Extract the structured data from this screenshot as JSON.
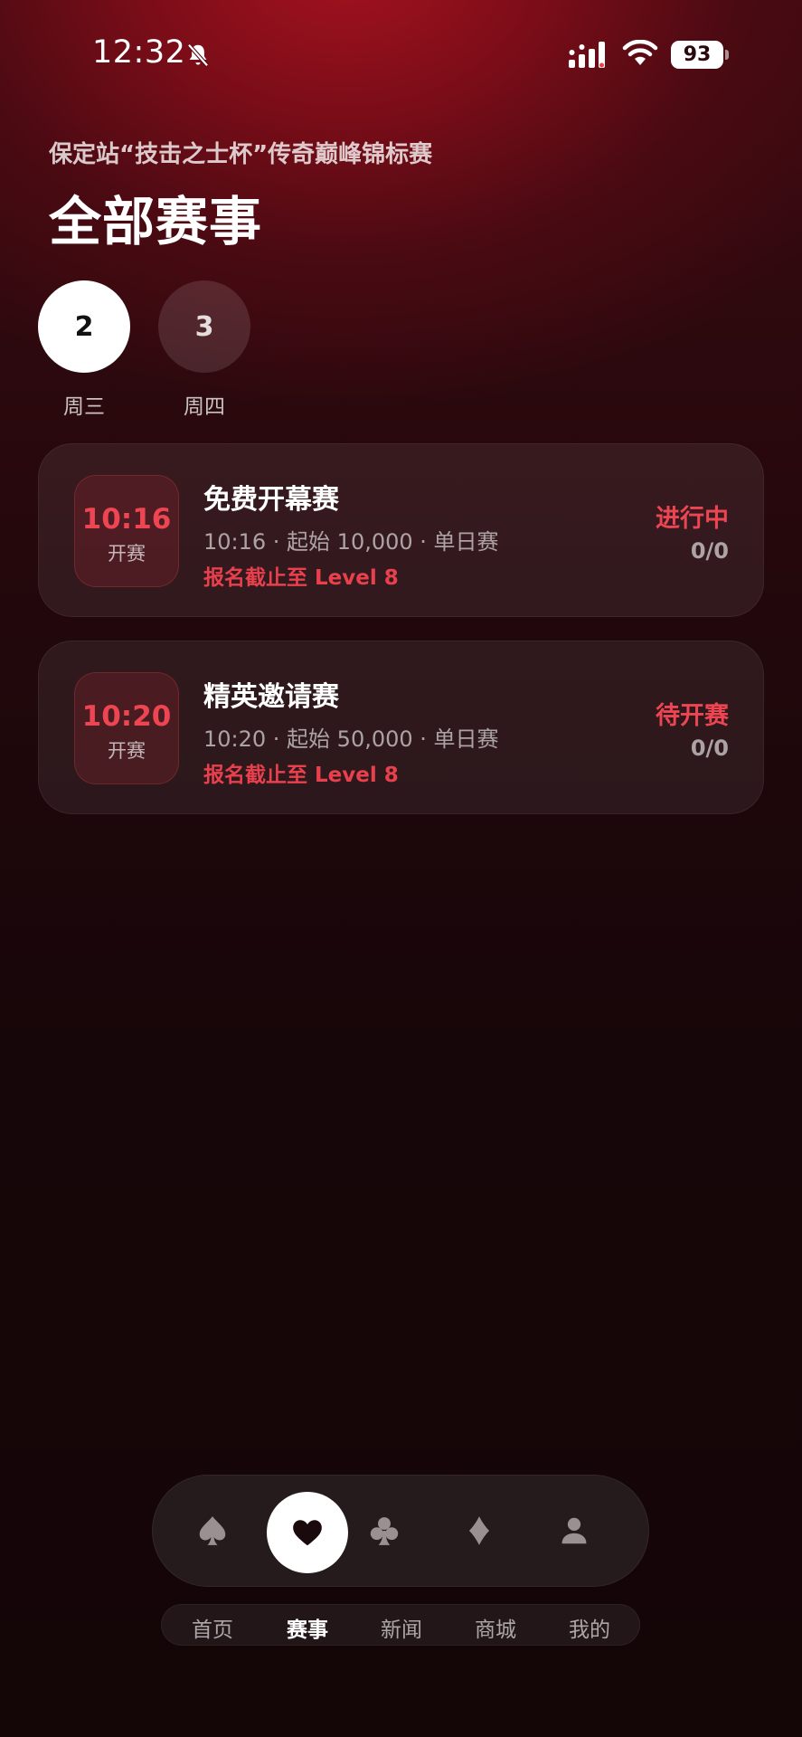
{
  "status_bar": {
    "time": "12:32",
    "battery": "93"
  },
  "header": {
    "subtitle": "保定站“技击之士杯”传奇巅峰锦标赛",
    "title": "全部赛事"
  },
  "days": [
    {
      "number": "2",
      "weekday": "周三",
      "selected": true
    },
    {
      "number": "3",
      "weekday": "周四",
      "selected": false
    }
  ],
  "events": [
    {
      "start_time": "10:16",
      "start_label": "开赛",
      "name": "免费开幕赛",
      "meta": "10:16 · 起始 10,000 · 单日赛",
      "deadline": "报名截止至 Level 8",
      "status": "进行中",
      "count": "0/0"
    },
    {
      "start_time": "10:20",
      "start_label": "开赛",
      "name": "精英邀请赛",
      "meta": "10:20 · 起始 50,000 · 单日赛",
      "deadline": "报名截止至 Level 8",
      "status": "待开赛",
      "count": "0/0"
    }
  ],
  "tabbar": {
    "icons": [
      "spade-icon",
      "heart-icon",
      "club-icon",
      "diamond-icon",
      "person-icon"
    ],
    "active_index": 1,
    "labels": [
      "首页",
      "赛事",
      "新闻",
      "商城",
      "我的"
    ]
  },
  "colors": {
    "accent": "#ee4552",
    "background_top": "#a5121f",
    "background_bottom": "#140507"
  }
}
